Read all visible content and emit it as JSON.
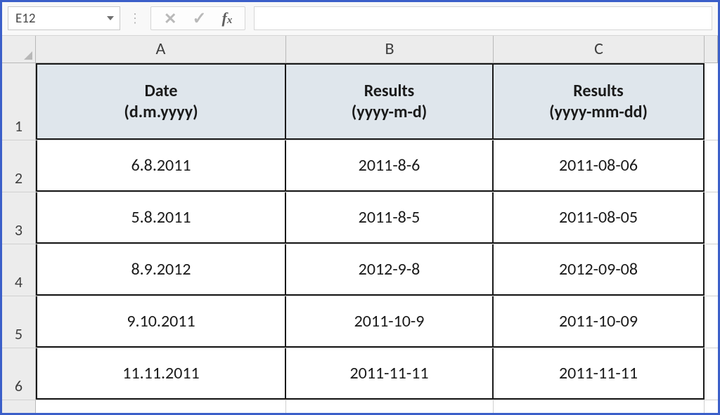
{
  "nameBox": {
    "value": "E12"
  },
  "formulaInput": {
    "value": ""
  },
  "columns": {
    "A": "A",
    "B": "B",
    "C": "C"
  },
  "rowNums": {
    "r1": "1",
    "r2": "2",
    "r3": "3",
    "r4": "4",
    "r5": "5",
    "r6": "6"
  },
  "headers": {
    "A": "Date\n(d.m.yyyy)",
    "B": "Results\n(yyyy-m-d)",
    "C": "Results\n(yyyy-mm-dd)"
  },
  "rows": [
    {
      "A": "6.8.2011",
      "B": "2011-8-6",
      "C": "2011-08-06"
    },
    {
      "A": "5.8.2011",
      "B": "2011-8-5",
      "C": "2011-08-05"
    },
    {
      "A": "8.9.2012",
      "B": "2012-9-8",
      "C": "2012-09-08"
    },
    {
      "A": "9.10.2011",
      "B": "2011-10-9",
      "C": "2011-10-09"
    },
    {
      "A": "11.11.2011",
      "B": "2011-11-11",
      "C": "2011-11-11"
    }
  ],
  "chart_data": {
    "type": "table",
    "title": "",
    "columns": [
      "Date (d.m.yyyy)",
      "Results (yyyy-m-d)",
      "Results (yyyy-mm-dd)"
    ],
    "rows": [
      [
        "6.8.2011",
        "2011-8-6",
        "2011-08-06"
      ],
      [
        "5.8.2011",
        "2011-8-5",
        "2011-08-05"
      ],
      [
        "8.9.2012",
        "2012-9-8",
        "2012-09-08"
      ],
      [
        "9.10.2011",
        "2011-10-9",
        "2011-10-09"
      ],
      [
        "11.11.2011",
        "2011-11-11",
        "2011-11-11"
      ]
    ]
  }
}
